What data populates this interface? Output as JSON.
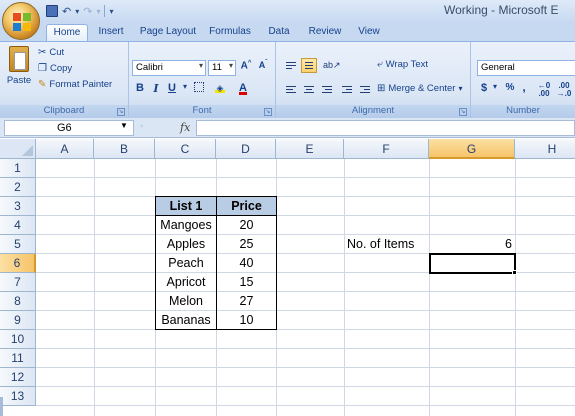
{
  "window": {
    "title": "Working - Microsoft E"
  },
  "quick_access": {
    "undo_glyph": "↶",
    "redo_glyph": "↷",
    "dropdown_glyph": "▾"
  },
  "tabs": [
    "Home",
    "Insert",
    "Page Layout",
    "Formulas",
    "Data",
    "Review",
    "View"
  ],
  "ribbon": {
    "clipboard": {
      "label": "Clipboard",
      "paste": "Paste",
      "cut": "Cut",
      "copy": "Copy",
      "format_painter": "Format Painter"
    },
    "font": {
      "label": "Font",
      "font_name": "Calibri",
      "font_size": "11",
      "bold": "B",
      "italic": "I",
      "underline": "U"
    },
    "alignment": {
      "label": "Alignment",
      "wrap_text": "Wrap Text",
      "merge_center": "Merge & Center"
    },
    "number": {
      "label": "Number",
      "format": "General",
      "currency": "$",
      "percent": "%",
      "comma": ","
    }
  },
  "formula_bar": {
    "name_box": "G6",
    "fx": "fx",
    "formula": ""
  },
  "columns": [
    "A",
    "B",
    "C",
    "D",
    "E",
    "F",
    "G",
    "H"
  ],
  "rows": [
    "1",
    "2",
    "3",
    "4",
    "5",
    "6",
    "7",
    "8",
    "9",
    "10",
    "11",
    "12",
    "13"
  ],
  "selected_cell": {
    "column": "G",
    "row": "6"
  },
  "table": {
    "headers": [
      "List 1",
      "Price"
    ],
    "rows": [
      [
        "Mangoes",
        "20"
      ],
      [
        "Apples",
        "25"
      ],
      [
        "Peach",
        "40"
      ],
      [
        "Apricot",
        "15"
      ],
      [
        "Melon",
        "27"
      ],
      [
        "Bananas",
        "10"
      ]
    ]
  },
  "summary": {
    "label": "No. of Items",
    "value": "6"
  },
  "colors": {
    "table_header_fill": "#b8cce4",
    "selected_header_fill": "#f7c46a",
    "ribbon_background": "#dbe6f5"
  }
}
